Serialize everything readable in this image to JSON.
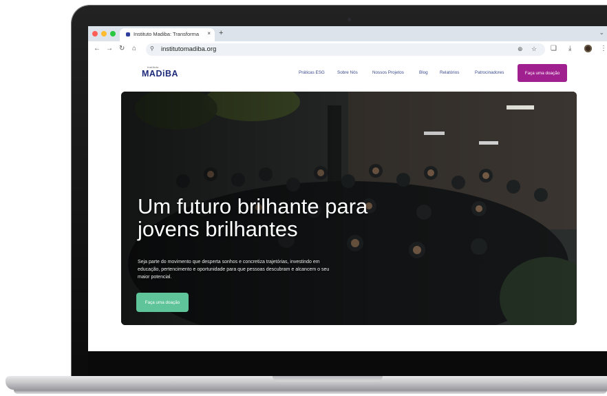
{
  "browser": {
    "tab_title": "Instituto Madiba: Transforma",
    "tab_close": "×",
    "new_tab": "+",
    "tab_menu": "⌄",
    "url": "institutomadiba.org",
    "icons": [
      "back-icon",
      "forward-icon",
      "reload-icon",
      "home-icon",
      "site-info-icon",
      "zoom-icon",
      "bookmark-star-icon",
      "extensions-icon",
      "download-icon",
      "profile-icon",
      "menu-icon"
    ]
  },
  "site": {
    "logo_top": "Instituto",
    "logo": "MADiBA",
    "nav": [
      "Práticas ESG",
      "Sobre Nós",
      "Nossos Projetos",
      "Blog",
      "Relatórios",
      "Patrocinadores"
    ],
    "donate_button": "Faça uma doação",
    "brand_color": "#a1208f",
    "cta_color": "#5fc49a"
  },
  "hero": {
    "headline": "Um futuro brilhante para jovens brilhantes",
    "subtitle": "Seja parte do movimento que desperta sonhos e concretiza trajetórias, investindo em educação, pertencimento e oportunidade para que pessoas descubram e alcancem o seu maior potencial.",
    "cta": "Faça uma doação"
  }
}
